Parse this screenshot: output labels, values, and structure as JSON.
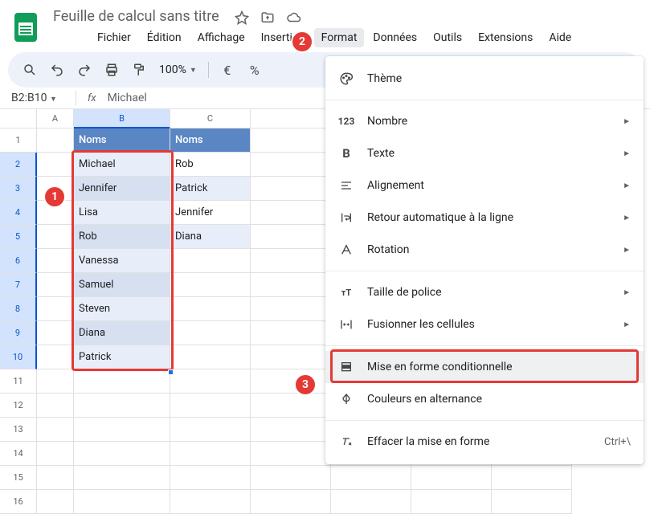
{
  "doc": {
    "title": "Feuille de calcul sans titre"
  },
  "menubar": [
    "Fichier",
    "Édition",
    "Affichage",
    "Insertion",
    "Format",
    "Données",
    "Outils",
    "Extensions",
    "Aide"
  ],
  "toolbar": {
    "zoom": "100%",
    "currency": "€",
    "percent": "%"
  },
  "namebox": {
    "ref": "B2:B10",
    "formula": "Michael"
  },
  "columns": [
    "A",
    "B",
    "C"
  ],
  "row_count": 16,
  "selection": {
    "col": "B",
    "rows_from": 2,
    "rows_to": 10
  },
  "table": {
    "headerB": "Noms",
    "headerC": "Noms",
    "colB": [
      "Michael",
      "Jennifer",
      "Lisa",
      "Rob",
      "Vanessa",
      "Samuel",
      "Steven",
      "Diana",
      "Patrick"
    ],
    "colC": [
      "Rob",
      "Patrick",
      "Jennifer",
      "Diana"
    ]
  },
  "format_menu": {
    "theme": "Thème",
    "number": "Nombre",
    "text": "Texte",
    "alignment": "Alignement",
    "wrap": "Retour automatique à la ligne",
    "rotation": "Rotation",
    "fontsize": "Taille de police",
    "merge": "Fusionner les cellules",
    "cond": "Mise en forme conditionnelle",
    "altcolors": "Couleurs en alternance",
    "clear": "Effacer la mise en forme",
    "clear_short": "Ctrl+\\"
  },
  "callouts": {
    "c1": "1",
    "c2": "2",
    "c3": "3"
  }
}
